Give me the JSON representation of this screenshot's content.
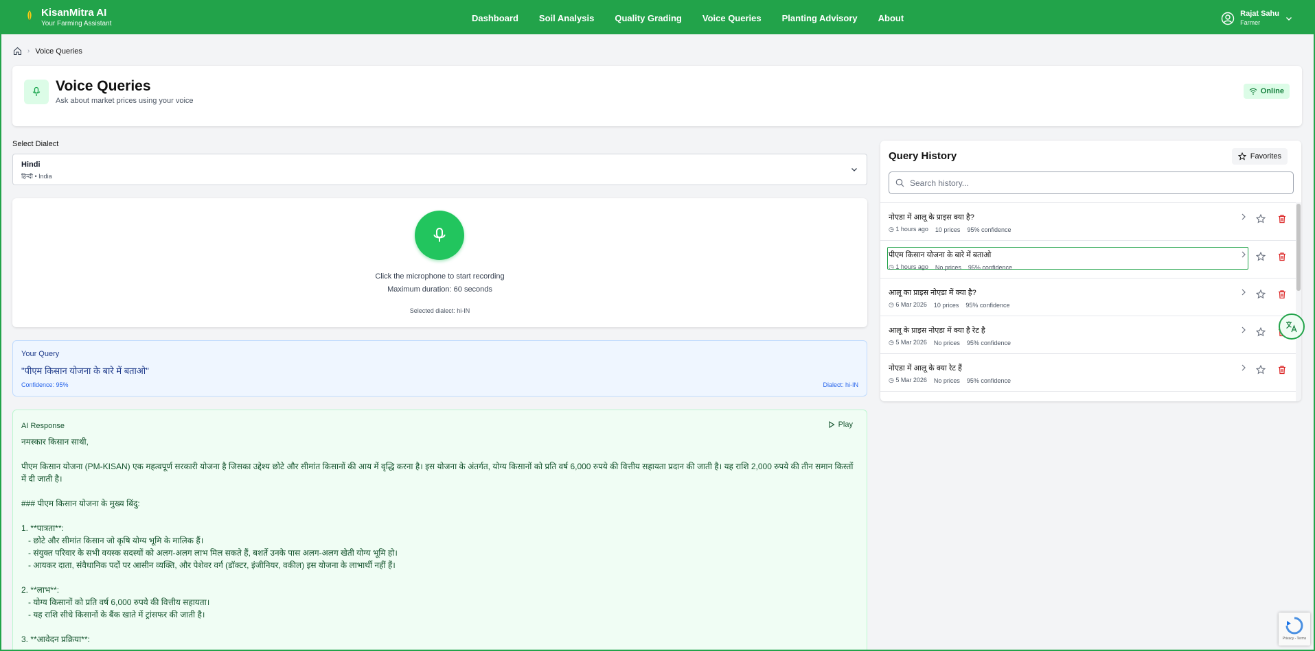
{
  "brand": {
    "title": "KisanMitra AI",
    "subtitle": "Your Farming Assistant"
  },
  "nav": {
    "items": [
      {
        "label": "Dashboard"
      },
      {
        "label": "Soil Analysis"
      },
      {
        "label": "Quality Grading"
      },
      {
        "label": "Voice Queries"
      },
      {
        "label": "Planting Advisory"
      },
      {
        "label": "About"
      }
    ]
  },
  "user": {
    "name": "Rajat Sahu",
    "role": "Farmer"
  },
  "breadcrumb": {
    "current": "Voice Queries"
  },
  "header": {
    "title": "Voice Queries",
    "subtitle": "Ask about market prices using your voice",
    "status": "Online"
  },
  "dialect": {
    "label": "Select Dialect",
    "selected_language": "Hindi",
    "selected_sub": "हिन्दी • India"
  },
  "recorder": {
    "hint": "Click the microphone to start recording",
    "max_duration": "Maximum duration: 60 seconds",
    "selected_dialect": "Selected dialect: hi-IN"
  },
  "query": {
    "label": "Your Query",
    "text": "\"पीएम किसान योजना के बारे में बताओ\"",
    "confidence": "Confidence: 95%",
    "dialect": "Dialect: hi-IN"
  },
  "response": {
    "label": "AI Response",
    "play_label": "Play",
    "body": "नमस्कार किसान साथी,\n\nपीएम किसान योजना (PM-KISAN) एक महत्वपूर्ण सरकारी योजना है जिसका उद्देश्य छोटे और सीमांत किसानों की आय में वृद्धि करना है। इस योजना के अंतर्गत, योग्य किसानों को प्रति वर्ष 6,000 रुपये की वित्तीय सहायता प्रदान की जाती है। यह राशि 2,000 रुपये की तीन समान किस्तों में दी जाती है।\n\n### पीएम किसान योजना के मुख्य बिंदु:\n\n1. **पात्रता**:\n   - छोटे और सीमांत किसान जो कृषि योग्य भूमि के मालिक हैं।\n   - संयुक्त परिवार के सभी वयस्क सदस्यों को अलग-अलग लाभ मिल सकते हैं, बशर्ते उनके पास अलग-अलग खेती योग्य भूमि हो।\n   - आयकर दाता, संवैधानिक पदों पर आसीन व्यक्ति, और पेशेवर वर्ग (डॉक्टर, इंजीनियर, वकील) इस योजना के लाभार्थी नहीं हैं।\n\n2. **लाभ**:\n   - योग्य किसानों को प्रति वर्ष 6,000 रुपये की वित्तीय सहायता।\n   - यह राशि सीधे किसानों के बैंक खाते में ट्रांसफर की जाती है।\n\n3. **आवेदन प्रक्रिया**:"
  },
  "history": {
    "title": "Query History",
    "favorites_label": "Favorites",
    "search_placeholder": "Search history...",
    "items": [
      {
        "query": "नोएडा में आलू के प्राइस क्या है?",
        "time": "1 hours ago",
        "prices": "10 prices",
        "confidence": "95% confidence"
      },
      {
        "query": "पीएम किसान योजना के बारे में बताओ",
        "time": "1 hours ago",
        "prices": "No prices",
        "confidence": "95% confidence"
      },
      {
        "query": "आलू का प्राइस नोएडा में क्या है?",
        "time": "6 Mar 2026",
        "prices": "10 prices",
        "confidence": "95% confidence"
      },
      {
        "query": "आलू के प्राइस नोएडा में क्या है रेट है",
        "time": "5 Mar 2026",
        "prices": "No prices",
        "confidence": "95% confidence"
      },
      {
        "query": "नोएडा में आलू के क्या रेट हैं",
        "time": "5 Mar 2026",
        "prices": "No prices",
        "confidence": "95% confidence"
      }
    ]
  },
  "recaptcha": {
    "text": "Privacy - Terms"
  }
}
